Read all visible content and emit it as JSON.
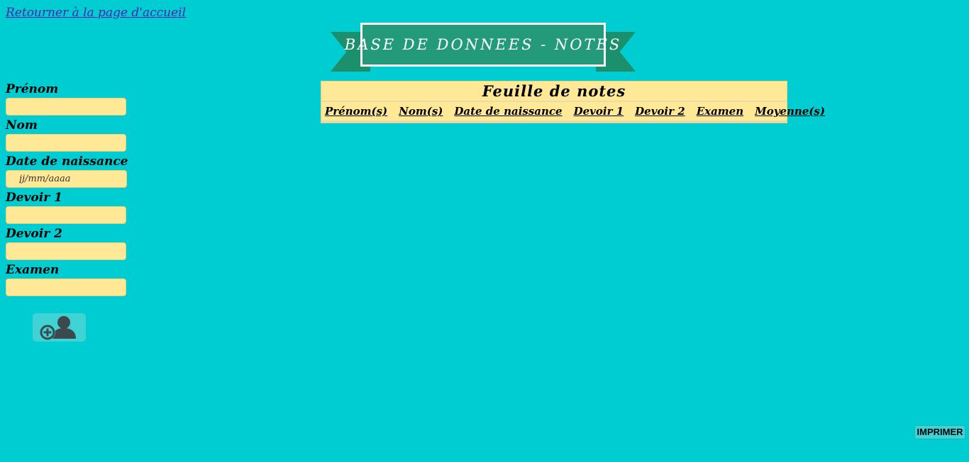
{
  "nav": {
    "home_link": "Retourner à la page d'accueil"
  },
  "banner": {
    "title": "BASE DE DONNEES - NOTES"
  },
  "form": {
    "fields": [
      {
        "label": "Prénom",
        "value": ""
      },
      {
        "label": "Nom",
        "value": ""
      },
      {
        "label": "Date de naissance",
        "placeholder": "jj/mm/aaaa"
      },
      {
        "label": "Devoir 1",
        "value": ""
      },
      {
        "label": "Devoir 2",
        "value": ""
      },
      {
        "label": "Examen",
        "value": ""
      }
    ],
    "add_button_icon": "add-user-icon"
  },
  "table": {
    "title": "Feuille de notes",
    "columns": [
      "Prénom(s)",
      "Nom(s)",
      "Date de naissance",
      "Devoir 1",
      "Devoir 2",
      "Examen",
      "Moyenne(s)"
    ],
    "rows": []
  },
  "print_button": "IMPRIMER",
  "colors": {
    "background": "#00cdd1",
    "banner": "#239a7a",
    "banner_tail": "#1c8f6c",
    "input_fill": "#ffe896",
    "link": "#5a1fb0",
    "icon": "#3d4a4d"
  }
}
